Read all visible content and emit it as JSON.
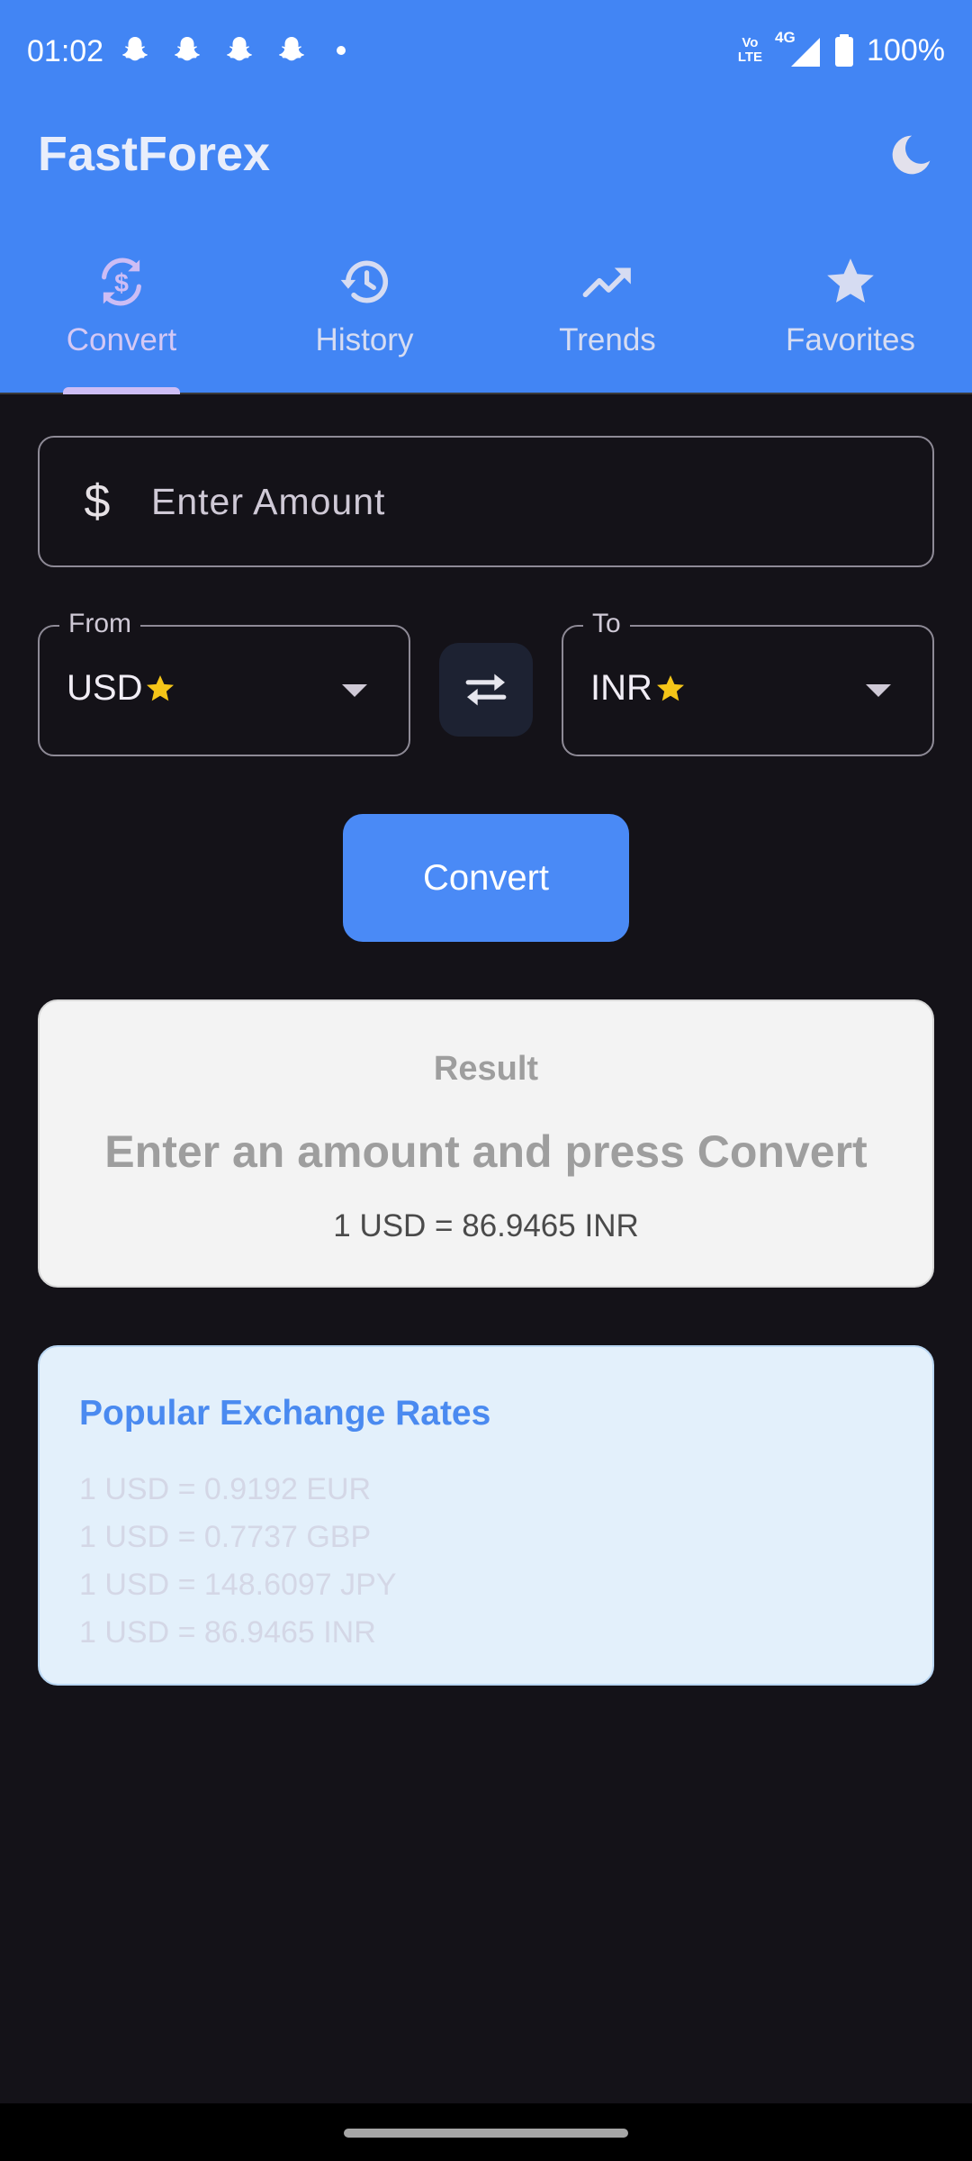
{
  "status_bar": {
    "time": "01:02",
    "notification_icons": [
      "snapchat-icon",
      "snapchat-icon",
      "snapchat-icon",
      "snapchat-icon"
    ],
    "volte_label_top": "Vo",
    "volte_label_bottom": "LTE",
    "network_label": "4G",
    "battery_percent": "100%"
  },
  "app": {
    "title": "FastForex",
    "theme_icon": "moon-icon",
    "header_color": "#4285f4"
  },
  "tabs": [
    {
      "label": "Convert",
      "icon": "currency-exchange-icon",
      "active": true
    },
    {
      "label": "History",
      "icon": "history-icon",
      "active": false
    },
    {
      "label": "Trends",
      "icon": "trending-up-icon",
      "active": false
    },
    {
      "label": "Favorites",
      "icon": "star-icon",
      "active": false
    }
  ],
  "amount": {
    "placeholder": "Enter Amount",
    "value": "",
    "prefix_icon": "$"
  },
  "from": {
    "legend": "From",
    "value": "USD",
    "favorite": true
  },
  "to": {
    "legend": "To",
    "value": "INR",
    "favorite": true
  },
  "convert_button": {
    "label": "Convert",
    "color": "#4a8af6"
  },
  "result": {
    "label": "Result",
    "value": "Enter an amount and press Convert",
    "rate": "1 USD = 86.9465 INR"
  },
  "popular": {
    "title": "Popular Exchange Rates",
    "items": [
      "1 USD = 0.9192 EUR",
      "1 USD = 0.7737 GBP",
      "1 USD = 148.6097 JPY",
      "1 USD = 86.9465 INR"
    ]
  }
}
